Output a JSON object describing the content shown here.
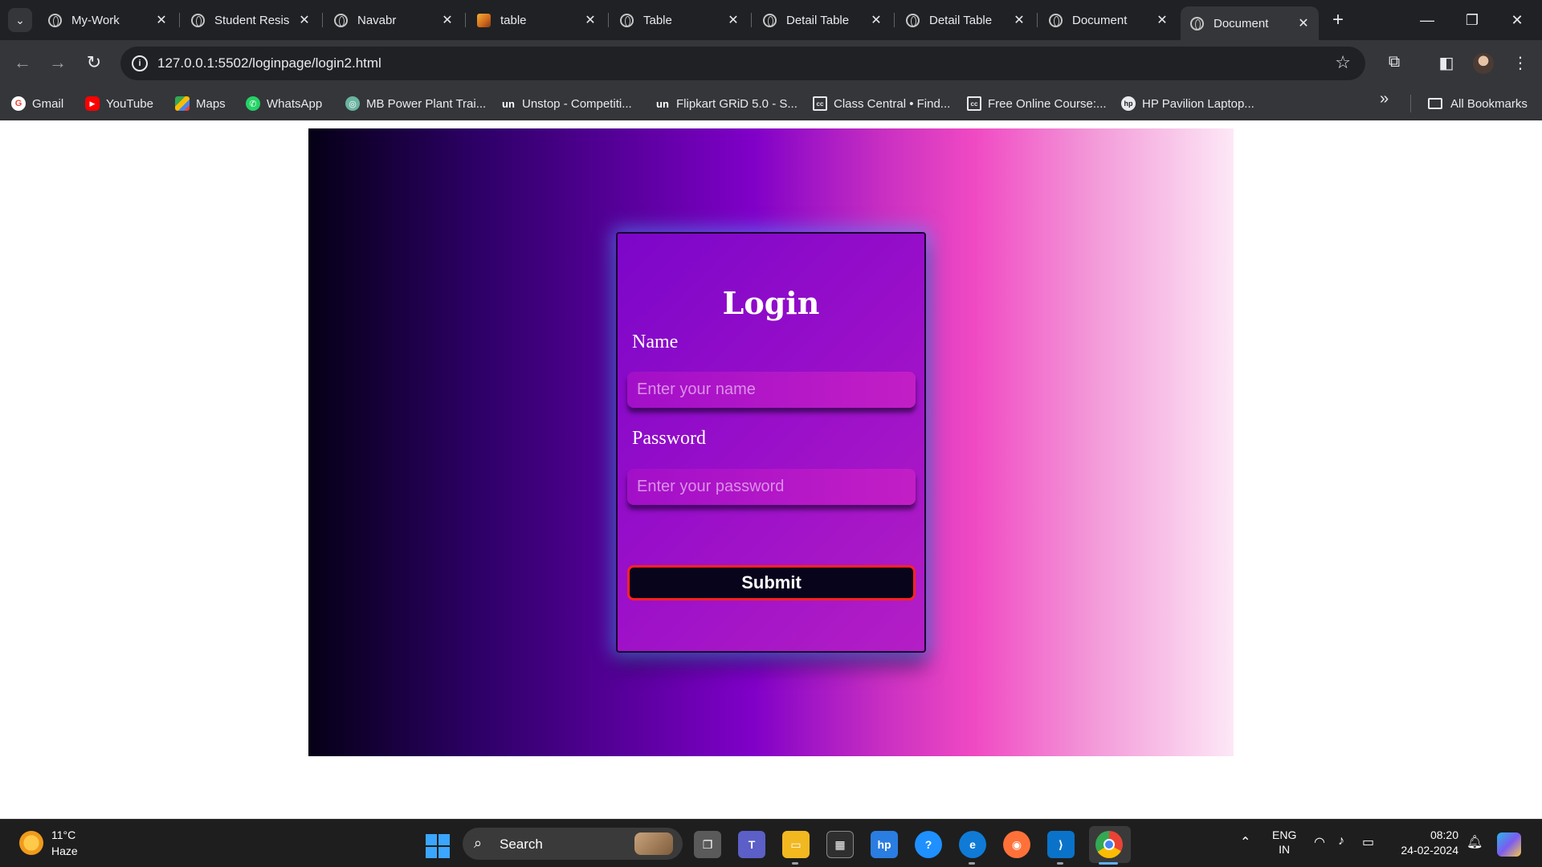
{
  "browser": {
    "tabs": [
      {
        "title": "My-Work",
        "favicon": "globe-icon",
        "active": false
      },
      {
        "title": "Student Resis",
        "favicon": "globe-icon",
        "active": false
      },
      {
        "title": "Navabr",
        "favicon": "globe-icon",
        "active": false
      },
      {
        "title": "table",
        "favicon": "image-icon",
        "active": false
      },
      {
        "title": "Table",
        "favicon": "globe-icon",
        "active": false
      },
      {
        "title": "Detail Table",
        "favicon": "globe-icon",
        "active": false
      },
      {
        "title": "Detail Table",
        "favicon": "globe-icon",
        "active": false
      },
      {
        "title": "Document",
        "favicon": "globe-icon",
        "active": false
      },
      {
        "title": "Document",
        "favicon": "globe-icon",
        "active": true
      }
    ],
    "url": "127.0.0.1:5502/loginpage/login2.html",
    "bookmarks": [
      {
        "label": "Gmail",
        "icon": "gmail-icon"
      },
      {
        "label": "YouTube",
        "icon": "youtube-icon"
      },
      {
        "label": "Maps",
        "icon": "maps-icon"
      },
      {
        "label": "WhatsApp",
        "icon": "whatsapp-icon"
      },
      {
        "label": "MB Power Plant Trai...",
        "icon": "mb-icon"
      },
      {
        "label": "Unstop - Competiti...",
        "icon": "unstop-icon"
      },
      {
        "label": "Flipkart GRiD 5.0 - S...",
        "icon": "unstop-icon"
      },
      {
        "label": "Class Central • Find...",
        "icon": "classcentral-icon"
      },
      {
        "label": "Free Online Course:...",
        "icon": "classcentral-icon"
      },
      {
        "label": "HP Pavilion Laptop...",
        "icon": "hp-icon"
      }
    ],
    "all_bookmarks_label": "All Bookmarks"
  },
  "page": {
    "login": {
      "title": "Login",
      "name_label": "Name",
      "name_placeholder": "Enter your name",
      "password_label": "Password",
      "password_placeholder": "Enter your password",
      "submit_label": "Submit"
    },
    "colors": {
      "gradient_start": "#050016",
      "gradient_mid": "#8000c8",
      "gradient_pink": "#f049c3",
      "gradient_end": "#fde8f6",
      "card": "#8a0ac9",
      "submit_bg": "#08041c",
      "submit_border": "#ff2222"
    }
  },
  "taskbar": {
    "weather_temp": "11°C",
    "weather_desc": "Haze",
    "search_label": "Search",
    "lang_top": "ENG",
    "lang_bottom": "IN",
    "time": "08:20",
    "date": "24-02-2024"
  }
}
